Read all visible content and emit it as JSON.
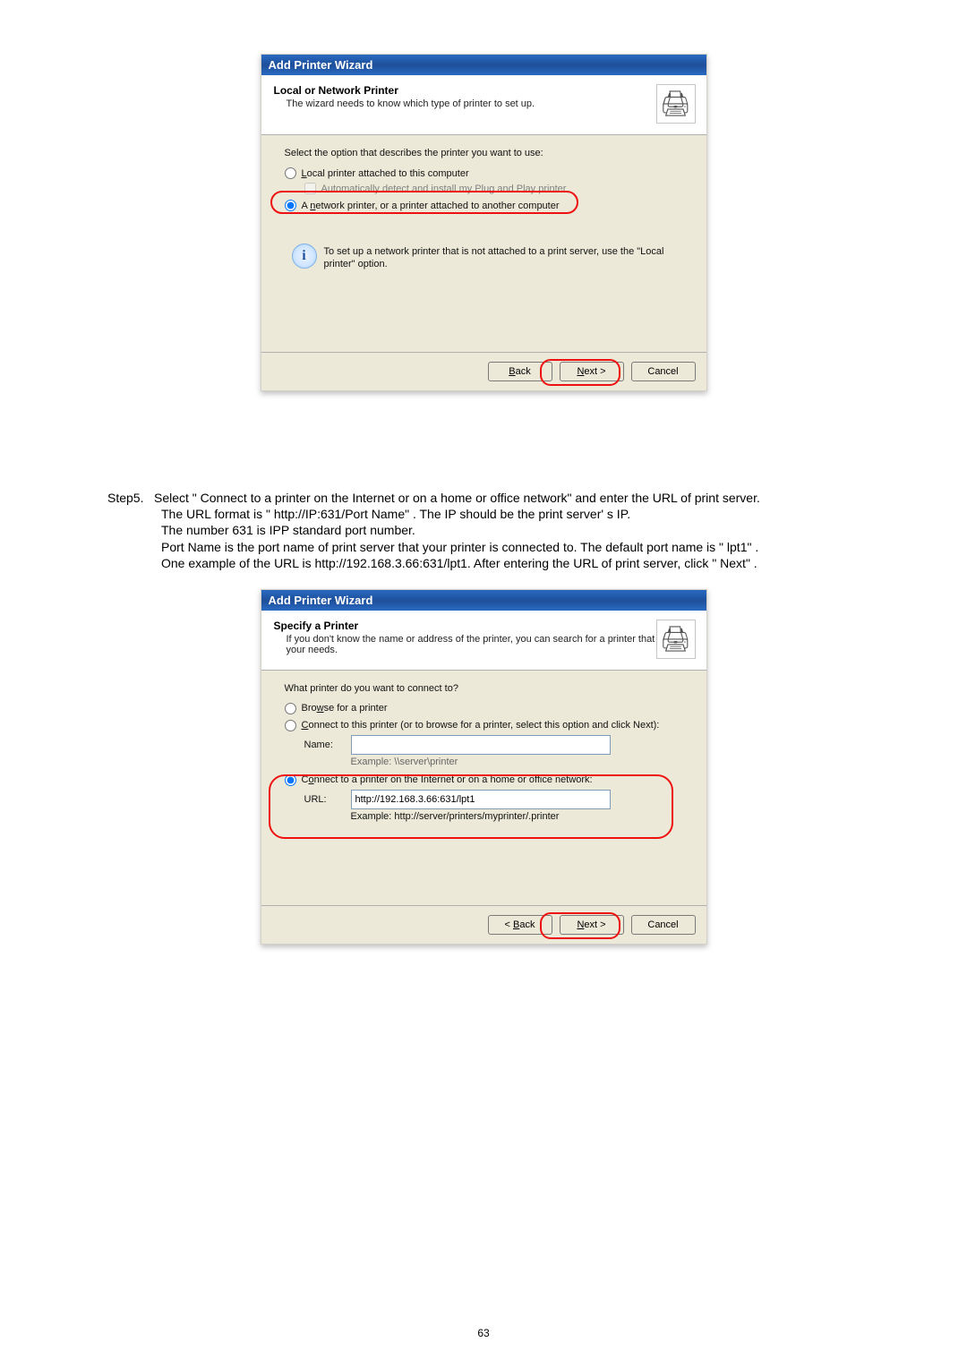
{
  "dialog1": {
    "title": "Add Printer Wizard",
    "heading": "Local or Network Printer",
    "subheading": "The wizard needs to know which type of printer to set up.",
    "prompt": "Select the option that describes the printer you want to use:",
    "opt_local": "Local printer attached to this computer",
    "opt_auto": "Automatically detect and install my Plug and Play printer",
    "opt_network": "A network printer, or a printer attached to another computer",
    "info_text": "To set up a network printer that is not attached to a print server, use the \"Local printer\" option.",
    "btn_back": "< Back",
    "btn_next": "Next >",
    "btn_cancel": "Cancel"
  },
  "step5": {
    "label": "Step5.",
    "line1": "Select \" Connect to a printer on the Internet or on a home or office network\" and enter the URL of print server.",
    "line2": "The URL format is \" http://IP:631/Port Name\" . The IP should be the print server' s IP.",
    "line3": "The number 631 is IPP standard port number.",
    "line4": "Port Name is the port name of print server that your printer is connected to. The default port name is \" lpt1\" .",
    "line5": "One example of the URL is http://192.168.3.66:631/lpt1. After entering the URL of print server, click \" Next\" ."
  },
  "dialog2": {
    "title": "Add Printer Wizard",
    "heading": "Specify a Printer",
    "subheading": "If you don't know the name or address of the printer, you can search for a printer that meets your needs.",
    "prompt": "What printer do you want to connect to?",
    "opt_browse": "Browse for a printer",
    "opt_connect_name": "Connect to this printer (or to browse for a printer, select this option and click Next):",
    "name_label": "Name:",
    "name_value": "",
    "name_example": "Example: \\\\server\\printer",
    "opt_connect_url": "Connect to a printer on the Internet or on a home or office network:",
    "url_label": "URL:",
    "url_value": "http://192.168.3.66:631/lpt1",
    "url_example": "Example: http://server/printers/myprinter/.printer",
    "btn_back": "< Back",
    "btn_next": "Next >",
    "btn_cancel": "Cancel"
  },
  "page_number": "63"
}
